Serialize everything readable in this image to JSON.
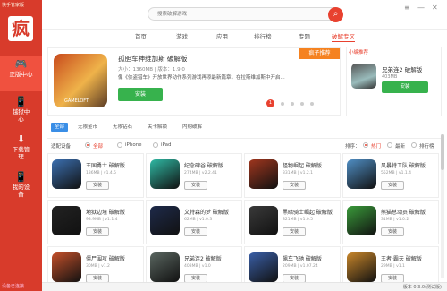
{
  "sidebar": {
    "title": "快手管家版",
    "logo_char": "疯",
    "items": [
      {
        "label": "正版中心",
        "icon": "gamepad-icon",
        "glyph": "🎮"
      },
      {
        "label": "越狱中心",
        "icon": "phone-unlock-icon",
        "glyph": "📱"
      },
      {
        "label": "下载管理",
        "icon": "download-icon",
        "glyph": "⬇"
      },
      {
        "label": "我的设备",
        "icon": "device-icon",
        "glyph": "📱"
      }
    ],
    "footer": "设备已连接"
  },
  "topbar": {
    "search_placeholder": "搜索破解游戏",
    "search_icon": "search-icon"
  },
  "tabs": [
    {
      "label": "首页"
    },
    {
      "label": "游戏"
    },
    {
      "label": "应用"
    },
    {
      "label": "排行榜"
    },
    {
      "label": "专题"
    },
    {
      "label": "破解专区"
    }
  ],
  "banner": {
    "title": "孤胆车神维加斯 破解版",
    "meta": "大小：1360MB | 版本：1.9.0",
    "desc": "像《侠盗猎车》开放世界动作系列游戏再添最新篇章，在拉斯维加斯中开启...",
    "install": "安装",
    "tag": "疯子推荐",
    "icon_text": "GAMELOFT"
  },
  "pager": {
    "current": "1"
  },
  "recommend": {
    "tag": "小编推荐",
    "name": "兄弟连2 破解版",
    "size": "403MB",
    "install": "安装"
  },
  "filters": [
    {
      "label": "全部"
    },
    {
      "label": "无限金币"
    },
    {
      "label": "无限钻石"
    },
    {
      "label": "关卡解锁"
    },
    {
      "label": "内购破解"
    }
  ],
  "device": {
    "label": "适配设备：",
    "options": [
      "全部",
      "iPhone",
      "iPad"
    ],
    "sort_label": "排序：",
    "sort_options": [
      "热门",
      "最新",
      "排行榜"
    ]
  },
  "games": [
    {
      "name": "王国勇士 破解版",
      "size": "136MB | v1.4.5",
      "install": "安装",
      "color": "#3b6fb0"
    },
    {
      "name": "纪念碑谷 破解版",
      "size": "274MB | v2.2.41",
      "install": "安装",
      "color": "#2fb8a3"
    },
    {
      "name": "怪物崛起 破解版",
      "size": "331MB | v1.2.1",
      "install": "安装",
      "color": "#a0361e"
    },
    {
      "name": "风暴特工队 破解版",
      "size": "552MB | v1.1.4",
      "install": "安装",
      "color": "#4f8ec4"
    },
    {
      "name": "地狱边境 破解版",
      "size": "93.9MB | v1.1.4",
      "install": "安装",
      "color": "#222222"
    },
    {
      "name": "文特森的梦 破解版",
      "size": "62MB | v1.0.3",
      "install": "安装",
      "color": "#1e2a4a"
    },
    {
      "name": "黑暗骑士崛起 破解版",
      "size": "821MB | v1.0.5",
      "install": "安装",
      "color": "#3a3a3a"
    },
    {
      "name": "熊猫总动员 破解版",
      "size": "31MB | v1.0.2",
      "install": "安装",
      "color": "#3a9b3a"
    },
    {
      "name": "僵尸围攻 破解版",
      "size": "30MB | v1.2",
      "install": "安装",
      "color": "#c4502a"
    },
    {
      "name": "兄弟连2 破解版",
      "size": "403MB | v1.0",
      "install": "安装",
      "color": "#5a6660"
    },
    {
      "name": "飙车飞驰 破解版",
      "size": "209MB | v1.07.24",
      "install": "安装",
      "color": "#3a5fa8"
    },
    {
      "name": "王者·霸天 破解版",
      "size": "29MB | v1.1",
      "install": "安装",
      "color": "#c8862a"
    }
  ],
  "footer": {
    "version": "版本 0.3.0(测试版)"
  }
}
